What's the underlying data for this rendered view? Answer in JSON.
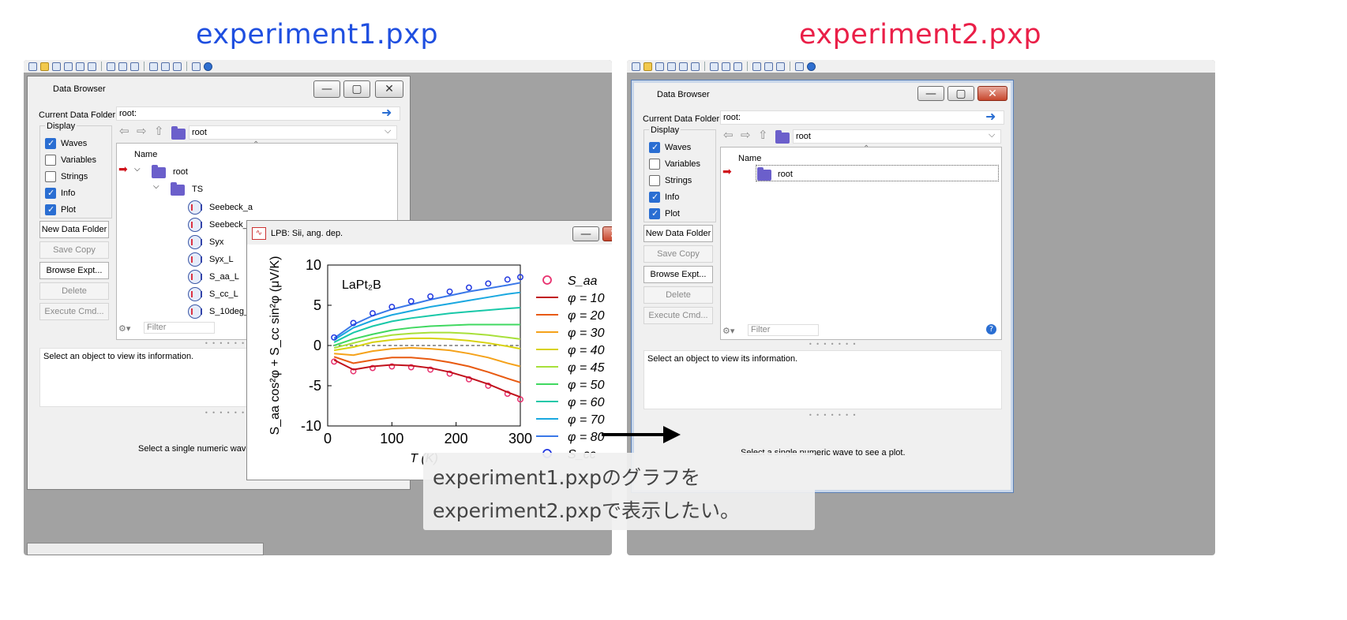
{
  "titles": {
    "left": "experiment1.pxp",
    "right": "experiment2.pxp",
    "left_color": "#1f4fe0",
    "right_color": "#ea1f48"
  },
  "browser_left": {
    "title": "Data Browser",
    "current_folder_label": "Current Data Folder:",
    "current_folder_value": "root:",
    "display_label": "Display",
    "checkboxes": [
      {
        "label": "Waves",
        "checked": true
      },
      {
        "label": "Variables",
        "checked": false
      },
      {
        "label": "Strings",
        "checked": false
      },
      {
        "label": "Info",
        "checked": true
      },
      {
        "label": "Plot",
        "checked": true
      }
    ],
    "buttons": [
      {
        "label": "New Data Folder",
        "enabled": true
      },
      {
        "label": "Save Copy",
        "enabled": false
      },
      {
        "label": "Browse Expt...",
        "enabled": true
      },
      {
        "label": "Delete",
        "enabled": false
      },
      {
        "label": "Execute Cmd...",
        "enabled": false
      }
    ],
    "folder_dropdown": "root",
    "tree_header": "Name",
    "tree": {
      "root": "root",
      "subfolder": "TS",
      "waves": [
        "Seebeck_a",
        "Seebeck_",
        "Syx",
        "Syx_L",
        "S_aa_L",
        "S_cc_L",
        "S_10deg_"
      ]
    },
    "filter_placeholder": "Filter",
    "info_text": "Select an object to view its information.",
    "plot_text": "Select a single numeric wave"
  },
  "browser_right": {
    "title": "Data Browser",
    "current_folder_label": "Current Data Folder:",
    "current_folder_value": "root:",
    "display_label": "Display",
    "checkboxes": [
      {
        "label": "Waves",
        "checked": true
      },
      {
        "label": "Variables",
        "checked": false
      },
      {
        "label": "Strings",
        "checked": false
      },
      {
        "label": "Info",
        "checked": true
      },
      {
        "label": "Plot",
        "checked": true
      }
    ],
    "buttons": [
      {
        "label": "New Data Folder",
        "enabled": true
      },
      {
        "label": "Save Copy",
        "enabled": false
      },
      {
        "label": "Browse Expt...",
        "enabled": true
      },
      {
        "label": "Delete",
        "enabled": false
      },
      {
        "label": "Execute Cmd...",
        "enabled": false
      }
    ],
    "folder_dropdown": "root",
    "tree_header": "Name",
    "tree": {
      "root": "root"
    },
    "filter_placeholder": "Filter",
    "info_text": "Select an object to view its information.",
    "plot_text": "Select a single numeric wave to see a plot."
  },
  "graph_window": {
    "title": "LPB: Sii, ang. dep."
  },
  "chart_data": {
    "type": "line",
    "annotation": "LaPt₂B",
    "xlabel": "T (K)",
    "ylabel": "S_aa cos²φ + S_cc sin²φ (μV/K)",
    "xlim": [
      0,
      300
    ],
    "ylim": [
      -10,
      10
    ],
    "xticks": [
      0,
      100,
      200,
      300
    ],
    "yticks": [
      -10,
      -5,
      0,
      5,
      10
    ],
    "x": [
      10,
      40,
      70,
      100,
      130,
      160,
      190,
      220,
      250,
      280,
      300
    ],
    "series": [
      {
        "name": "S_aa",
        "kind": "markers",
        "color": "#e8306e",
        "values": [
          -2.0,
          -3.2,
          -2.8,
          -2.6,
          -2.7,
          -3.0,
          -3.5,
          -4.2,
          -5.0,
          -6.0,
          -6.7
        ]
      },
      {
        "name": "φ = 10",
        "kind": "line",
        "color": "#c0101a",
        "values": [
          -1.8,
          -3.0,
          -2.6,
          -2.4,
          -2.5,
          -2.8,
          -3.3,
          -4.0,
          -4.8,
          -5.8,
          -6.4
        ]
      },
      {
        "name": "φ = 20",
        "kind": "line",
        "color": "#e85a10",
        "values": [
          -1.4,
          -2.2,
          -1.8,
          -1.5,
          -1.5,
          -1.7,
          -2.1,
          -2.6,
          -3.3,
          -4.1,
          -4.6
        ]
      },
      {
        "name": "φ = 30",
        "kind": "line",
        "color": "#f5a21a",
        "values": [
          -1.0,
          -1.2,
          -0.7,
          -0.4,
          -0.3,
          -0.4,
          -0.6,
          -1.0,
          -1.5,
          -2.2,
          -2.6
        ]
      },
      {
        "name": "φ = 40",
        "kind": "line",
        "color": "#d8d210",
        "values": [
          -0.6,
          -0.2,
          0.4,
          0.7,
          0.9,
          0.9,
          0.8,
          0.6,
          0.3,
          -0.1,
          -0.4
        ]
      },
      {
        "name": "φ = 45",
        "kind": "line",
        "color": "#a8e03a",
        "values": [
          -0.3,
          0.3,
          0.9,
          1.3,
          1.5,
          1.6,
          1.6,
          1.5,
          1.3,
          1.0,
          0.8
        ]
      },
      {
        "name": "φ = 50",
        "kind": "line",
        "color": "#40d860",
        "values": [
          0.0,
          0.8,
          1.4,
          1.9,
          2.2,
          2.4,
          2.5,
          2.6,
          2.6,
          2.6,
          2.6
        ]
      },
      {
        "name": "φ = 60",
        "kind": "line",
        "color": "#18c8a8",
        "values": [
          0.4,
          1.6,
          2.4,
          3.0,
          3.4,
          3.7,
          4.0,
          4.2,
          4.4,
          4.6,
          4.7
        ]
      },
      {
        "name": "φ = 70",
        "kind": "line",
        "color": "#1aa8e0",
        "values": [
          0.7,
          2.2,
          3.1,
          3.8,
          4.3,
          4.8,
          5.2,
          5.6,
          6.0,
          6.4,
          6.6
        ]
      },
      {
        "name": "φ = 80",
        "kind": "line",
        "color": "#3a78e8",
        "values": [
          0.9,
          2.6,
          3.7,
          4.5,
          5.1,
          5.7,
          6.2,
          6.7,
          7.1,
          7.5,
          7.8
        ]
      },
      {
        "name": "S_cc",
        "kind": "markers",
        "color": "#2238e0",
        "values": [
          1.0,
          2.8,
          4.0,
          4.8,
          5.5,
          6.1,
          6.7,
          7.2,
          7.7,
          8.2,
          8.5
        ]
      }
    ],
    "legend_labels": [
      "S_aa",
      "φ = 10",
      "φ = 20",
      "φ = 30",
      "φ = 40",
      "φ = 45",
      "φ = 50",
      "φ = 60",
      "φ = 70",
      "φ = 80",
      "S_cc"
    ]
  },
  "message": {
    "line1": "experiment1.pxpのグラフを",
    "line2": "experiment2.pxpで表示したい。"
  }
}
